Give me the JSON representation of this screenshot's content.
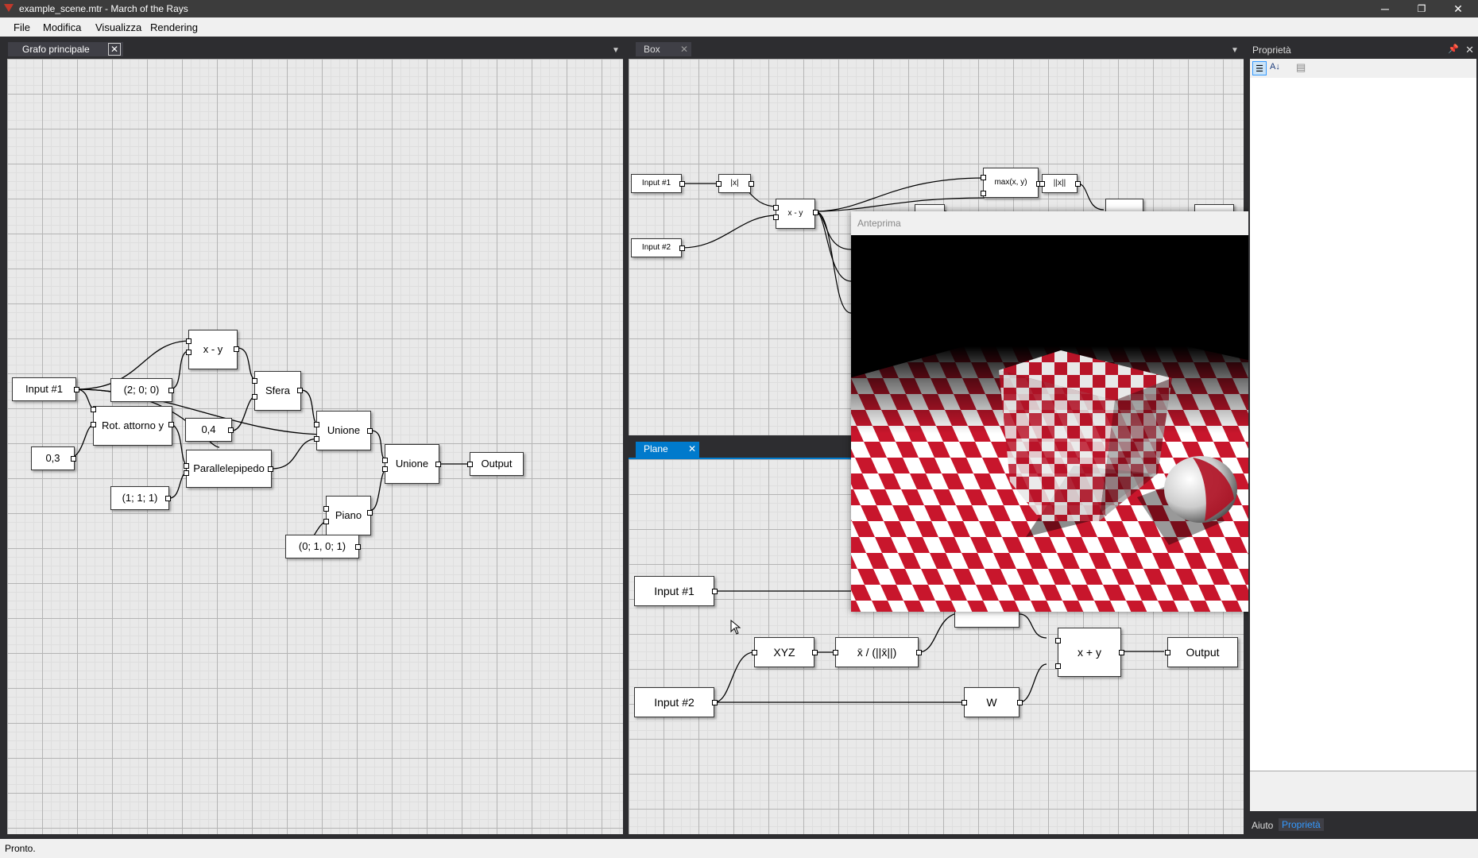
{
  "window": {
    "title": "example_scene.mtr - March of the Rays",
    "minimize": "─",
    "maximize": "❐",
    "close": "✕"
  },
  "menu": [
    "File",
    "Modifica",
    "Visualizza",
    "Rendering"
  ],
  "tabs": {
    "main": "Grafo principale",
    "box": "Box",
    "plane": "Plane",
    "close_glyph": "✕",
    "dropdown_glyph": "▼"
  },
  "main_graph": {
    "input1": "Input #1",
    "c030": "0,3",
    "v200": "(2; 0; 0)",
    "xmy": "x - y",
    "rot": "Rot. attorno y",
    "c04": "0,4",
    "sfera": "Sfera",
    "para": "Parallelepipedo",
    "v111": "(1; 1; 1)",
    "unione1": "Unione",
    "unione2": "Unione",
    "output": "Output",
    "piano": "Piano",
    "v0101": "(0; 1, 0; 1)"
  },
  "box_graph": {
    "input1": "Input #1",
    "input2": "Input #2",
    "abs": "|x|",
    "xmy": "x - y",
    "max": "max(x, y)",
    "norm": "||x||"
  },
  "plane_graph": {
    "input1": "Input #1",
    "input2": "Input #2",
    "xyz": "XYZ",
    "normalize": "x̄ / (||x̄||)",
    "w": "W",
    "xpy": "x + y",
    "output": "Output"
  },
  "preview": {
    "title": "Anteprima"
  },
  "properties": {
    "title": "Proprietà",
    "pin_glyph": "📌",
    "close_glyph": "✕",
    "toolbar": {
      "categorized_glyph": "☰",
      "alphabetical_glyph": "A↓",
      "pages_glyph": "▤"
    },
    "bottom_tabs": [
      "Aiuto",
      "Proprietà"
    ],
    "accent": "#007acc"
  },
  "status": "Pronto."
}
